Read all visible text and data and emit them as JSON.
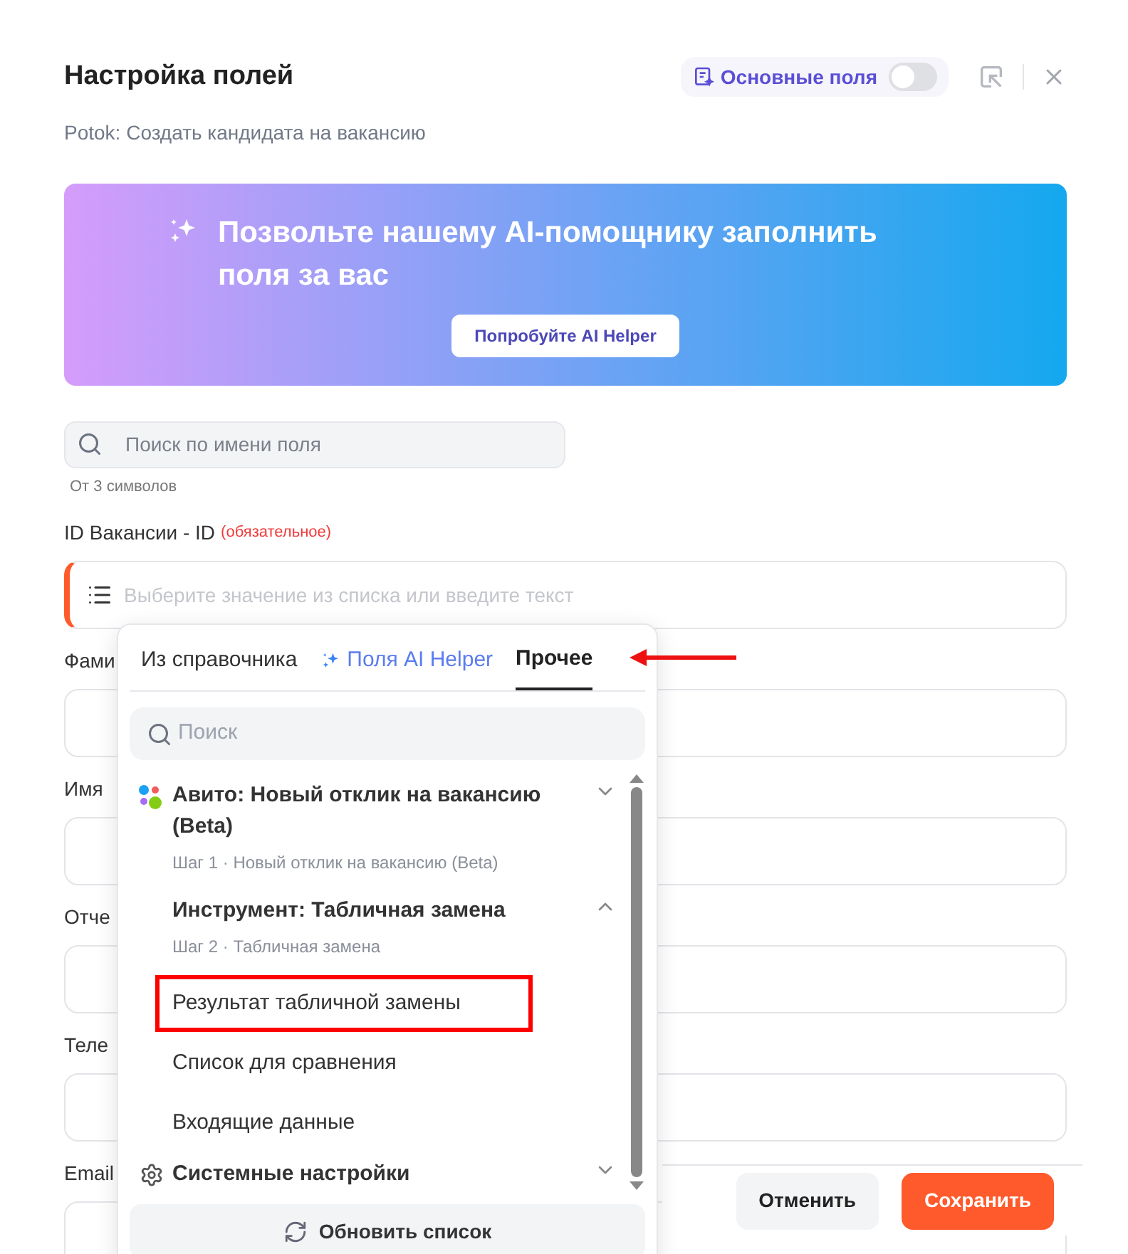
{
  "header": {
    "title": "Настройка полей",
    "subtitle": "Potok: Создать кандидата на вакансию",
    "main_fields_toggle": {
      "label": "Основные поля",
      "on": false
    }
  },
  "banner": {
    "title": "Позвольте нашему AI-помощнику заполнить поля за вас",
    "button": "Попробуйте AI Helper"
  },
  "search": {
    "placeholder": "Поиск по имени поля",
    "hint": "От 3 символов"
  },
  "fields": [
    {
      "label": "ID Вакансии - ID",
      "required_note": "(обязательное)",
      "placeholder": "Выберите значение из списка или введите текст",
      "required": true
    },
    {
      "label": "Фами",
      "required": false
    },
    {
      "label": "Имя",
      "required": false
    },
    {
      "label": "Отче",
      "required": false
    },
    {
      "label": "Теле",
      "required": false
    },
    {
      "label": "Email",
      "required": false
    }
  ],
  "dropdown": {
    "tabs": [
      {
        "label": "Из справочника",
        "kind": "plain",
        "selected": false
      },
      {
        "label": "Поля AI Helper",
        "kind": "ai",
        "selected": false
      },
      {
        "label": "Прочее",
        "kind": "plain",
        "selected": true
      }
    ],
    "search_placeholder": "Поиск",
    "groups": [
      {
        "kind": "app",
        "title": "Авито: Новый отклик на вакансию (Beta)",
        "subtitle": "Шаг 1 · Новый отклик на вакансию (Beta)",
        "expanded": false
      },
      {
        "kind": "tool",
        "title": "Инструмент: Табличная замена",
        "subtitle": "Шаг 2 · Табличная замена",
        "expanded": true,
        "children": [
          {
            "label": "Результат табличной замены",
            "highlighted": true
          },
          {
            "label": "Список для сравнения",
            "highlighted": false
          },
          {
            "label": "Входящие данные",
            "highlighted": false
          }
        ]
      },
      {
        "kind": "system",
        "title": "Системные настройки",
        "expanded": false
      }
    ],
    "refresh_button": "Обновить список"
  },
  "annotations": [
    {
      "kind": "arrow"
    }
  ],
  "footer": {
    "cancel": "Отменить",
    "save": "Сохранить"
  }
}
